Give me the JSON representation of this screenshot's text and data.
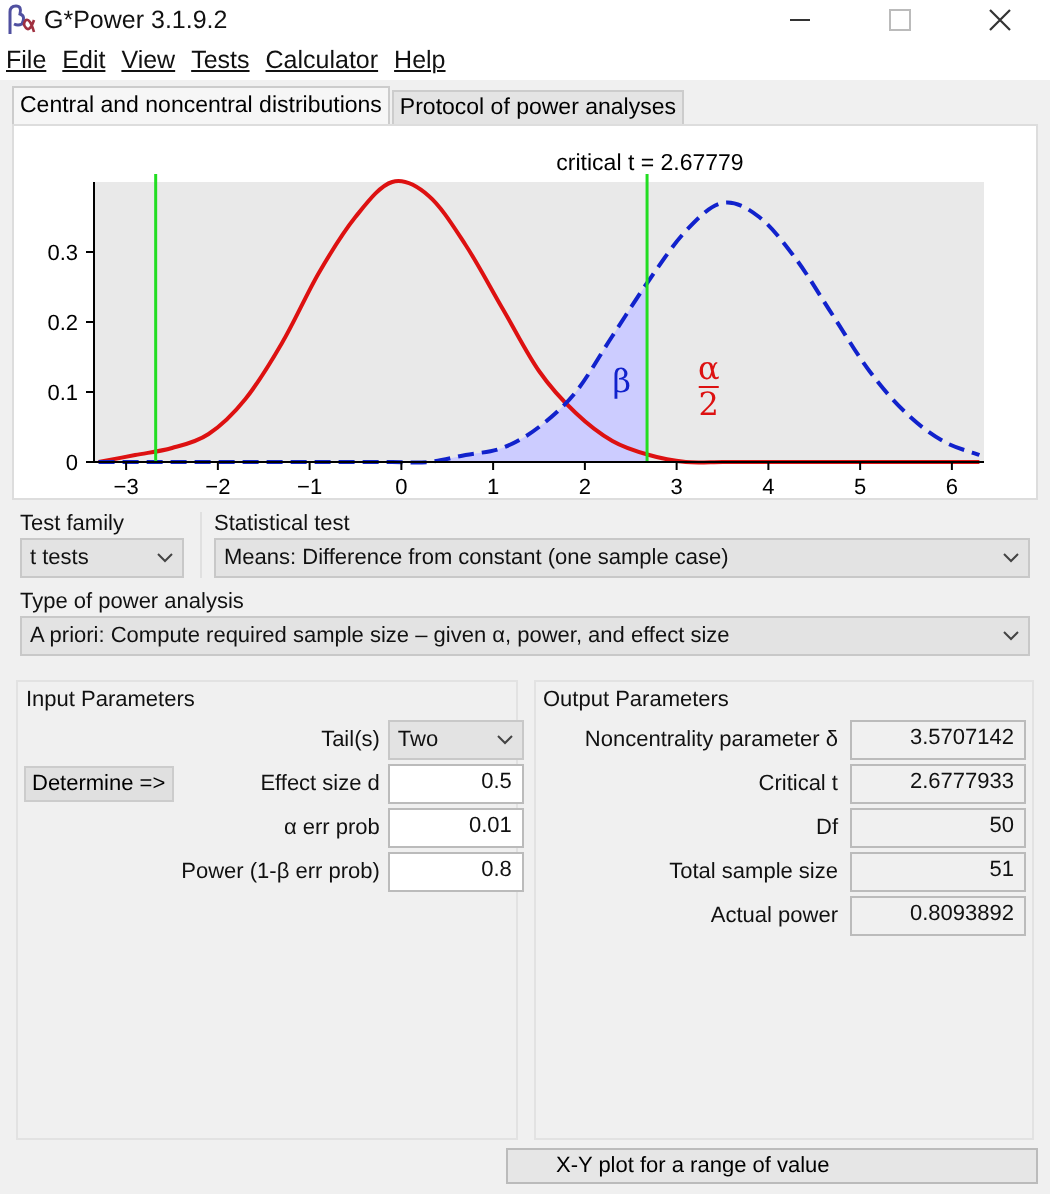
{
  "window": {
    "title": "G*Power 3.1.9.2"
  },
  "menu": [
    "File",
    "Edit",
    "View",
    "Tests",
    "Calculator",
    "Help"
  ],
  "tabs": [
    {
      "label": "Central and noncentral distributions",
      "selected": true
    },
    {
      "label": "Protocol of power analyses",
      "selected": false
    }
  ],
  "chart_data": {
    "type": "line",
    "title": "critical t = 2.67779",
    "x": [
      -3.3,
      -2.9,
      -2.5,
      -2.1,
      -1.7,
      -1.3,
      -0.9,
      -0.5,
      -0.1,
      0.3,
      0.7,
      1.1,
      1.5,
      1.9,
      2.3,
      2.7,
      3.1,
      3.5,
      3.9,
      4.3,
      4.7,
      5.1,
      5.5,
      5.9,
      6.3
    ],
    "series": [
      {
        "color": "#dd1111",
        "line_style": "solid",
        "values": [
          0,
          0.01,
          0.02,
          0.04,
          0.09,
          0.17,
          0.27,
          0.35,
          0.4,
          0.38,
          0.31,
          0.22,
          0.13,
          0.07,
          0.03,
          0.01,
          0,
          0,
          0,
          0,
          0,
          0,
          0,
          0,
          0
        ]
      },
      {
        "color": "#1122cc",
        "line_style": "dashed",
        "values": [
          0,
          0,
          0,
          0,
          0,
          0,
          0,
          0,
          0,
          0,
          0.01,
          0.02,
          0.05,
          0.1,
          0.18,
          0.26,
          0.33,
          0.37,
          0.35,
          0.29,
          0.21,
          0.13,
          0.07,
          0.03,
          0.01
        ]
      }
    ],
    "xlim": [
      -3.35,
      6.35
    ],
    "ylim": [
      0,
      0.4
    ],
    "xticks": [
      -3,
      -2,
      -1,
      0,
      1,
      2,
      3,
      4,
      5,
      6
    ],
    "yticks": [
      0,
      0.1,
      0.2,
      0.3
    ],
    "ref_lines": [
      {
        "axis": "x",
        "value": -2.67779,
        "color": "#22dd22"
      },
      {
        "axis": "x",
        "value": 2.67779,
        "color": "#22dd22"
      }
    ],
    "annotations": [
      "β",
      "α",
      "2"
    ]
  },
  "test_family": {
    "label": "Test family",
    "value": "t tests"
  },
  "statistical_test": {
    "label": "Statistical test",
    "value": "Means: Difference from constant (one sample case)"
  },
  "power_analysis_type": {
    "label": "Type of power analysis",
    "value": "A priori: Compute required sample size – given α, power, and effect size"
  },
  "input_parameters": {
    "title": "Input Parameters",
    "determine_button": "Determine =>",
    "fields": [
      {
        "kind": "dropdown",
        "label": "Tail(s)",
        "value": "Two"
      },
      {
        "kind": "input",
        "label": "Effect size d",
        "value": "0.5"
      },
      {
        "kind": "input",
        "label": "α err prob",
        "value": "0.01"
      },
      {
        "kind": "input",
        "label": "Power (1-β err prob)",
        "value": "0.8"
      }
    ]
  },
  "output_parameters": {
    "title": "Output Parameters",
    "fields": [
      {
        "label": "Noncentrality parameter δ",
        "value": "3.5707142"
      },
      {
        "label": "Critical t",
        "value": "2.6777933"
      },
      {
        "label": "Df",
        "value": "50"
      },
      {
        "label": "Total sample size",
        "value": "51"
      },
      {
        "label": "Actual power",
        "value": "0.8093892"
      }
    ]
  },
  "xy_plot_button": "X-Y plot for a range of value"
}
